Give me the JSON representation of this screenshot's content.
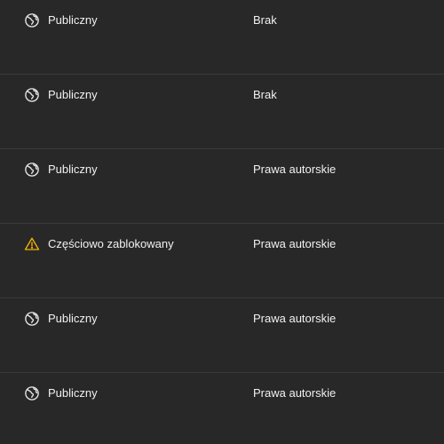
{
  "rows": [
    {
      "visibility": "Publiczny",
      "visibility_icon": "globe-icon",
      "restrictions": "Brak"
    },
    {
      "visibility": "Publiczny",
      "visibility_icon": "globe-icon",
      "restrictions": "Brak"
    },
    {
      "visibility": "Publiczny",
      "visibility_icon": "globe-icon",
      "restrictions": "Prawa autorskie"
    },
    {
      "visibility": "Częściowo zablokowany",
      "visibility_icon": "warning-icon",
      "restrictions": "Prawa autorskie"
    },
    {
      "visibility": "Publiczny",
      "visibility_icon": "globe-icon",
      "restrictions": "Prawa autorskie"
    },
    {
      "visibility": "Publiczny",
      "visibility_icon": "globe-icon",
      "restrictions": "Prawa autorskie"
    }
  ],
  "colors": {
    "background": "#282828",
    "text": "#f1f1f1",
    "divider": "#3a3a3a",
    "icon": "#e8e8e8",
    "warning": "#f2b400"
  }
}
